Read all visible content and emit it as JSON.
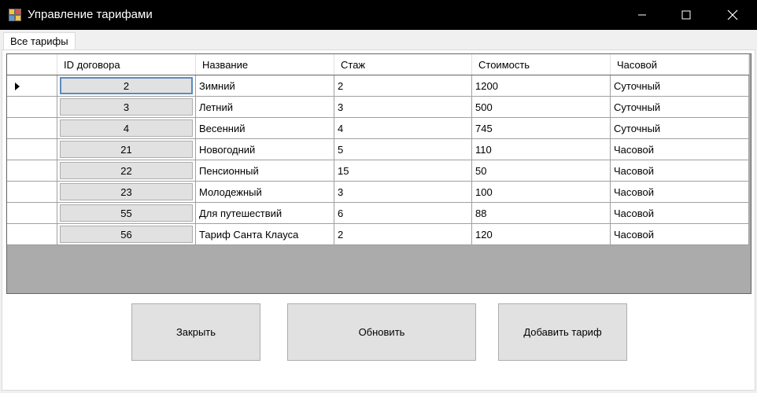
{
  "window": {
    "title": "Управление тарифами"
  },
  "tabs": [
    {
      "label": "Все тарифы"
    }
  ],
  "grid": {
    "columns": [
      "ID договора",
      "Название",
      "Стаж",
      "Стоимость",
      "Часовой"
    ],
    "rows": [
      {
        "id": "2",
        "name": "Зимний",
        "stage": "2",
        "cost": "1200",
        "type": "Суточный"
      },
      {
        "id": "3",
        "name": "Летний",
        "stage": "3",
        "cost": "500",
        "type": "Суточный"
      },
      {
        "id": "4",
        "name": "Весенний",
        "stage": "4",
        "cost": "745",
        "type": "Суточный"
      },
      {
        "id": "21",
        "name": "Новогодний",
        "stage": "5",
        "cost": "110",
        "type": "Часовой"
      },
      {
        "id": "22",
        "name": "Пенсионный",
        "stage": "15",
        "cost": "50",
        "type": "Часовой"
      },
      {
        "id": "23",
        "name": "Молодежный",
        "stage": "3",
        "cost": "100",
        "type": "Часовой"
      },
      {
        "id": "55",
        "name": "Для путешествий",
        "stage": "6",
        "cost": "88",
        "type": "Часовой"
      },
      {
        "id": "56",
        "name": "Тариф Санта Клауса",
        "stage": "2",
        "cost": "120",
        "type": "Часовой"
      }
    ]
  },
  "buttons": {
    "close": "Закрыть",
    "refresh": "Обновить",
    "add": "Добавить тариф"
  },
  "colors": {
    "titlebar": "#000000",
    "grid_background": "#ababab",
    "button_face": "#e1e1e1",
    "selection_border": "#5a8ac0"
  },
  "icons": {
    "app": "app-grid-icon",
    "minimize": "minimize-icon",
    "maximize": "maximize-icon",
    "close": "close-icon",
    "current_row": "row-pointer-icon"
  }
}
